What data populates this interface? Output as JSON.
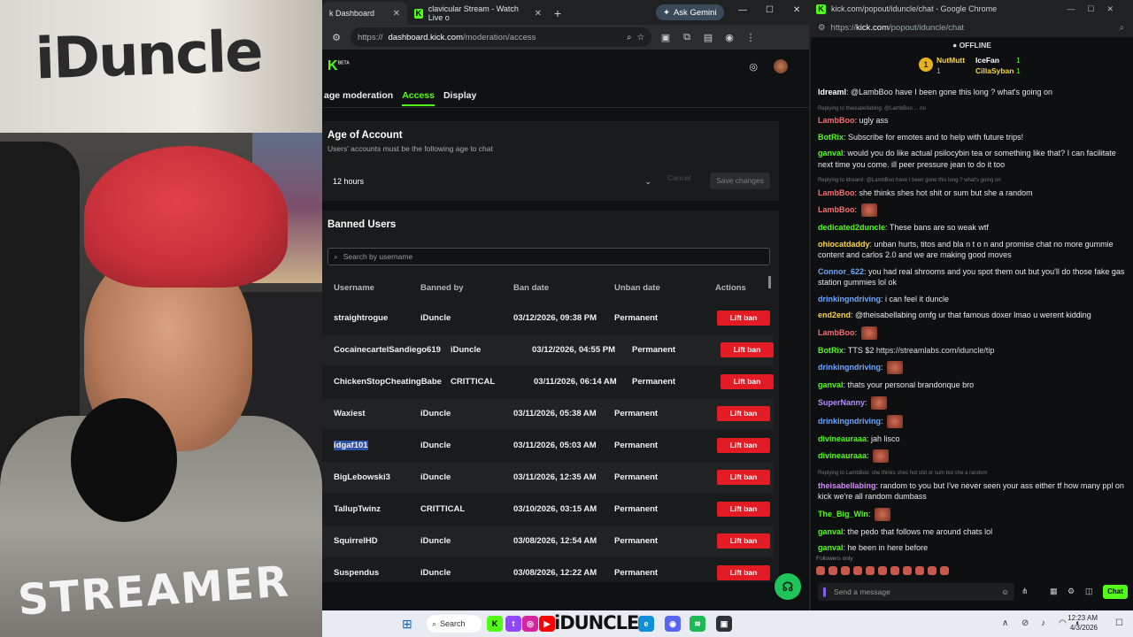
{
  "webcam": {
    "wall_logo": "iDuncle",
    "shirt_text": "STREAMER"
  },
  "browser": {
    "tabs": [
      {
        "label": "k Dashboard",
        "close": "✕"
      },
      {
        "label": "clavicular Stream - Watch Live o",
        "close": "✕"
      }
    ],
    "new_tab": "+",
    "gemini_label": "Ask Gemini",
    "window_controls": [
      "—",
      "☐",
      "✕"
    ],
    "url_prefix": "https://",
    "url_host": "dashboard.kick.com",
    "url_path": "/moderation/access"
  },
  "kick": {
    "logo": "K",
    "logo_badge": "BETA",
    "subtabs": [
      "age moderation",
      "Access",
      "Display"
    ],
    "age": {
      "title": "Age of Account",
      "subtitle": "Users' accounts must be the following age to chat",
      "selected": "12 hours",
      "cancel": "Cancel",
      "save": "Save changes"
    },
    "banned": {
      "title": "Banned Users",
      "search_placeholder": "Search by username",
      "columns": [
        "Username",
        "Banned by",
        "Ban date",
        "Unban date",
        "Actions"
      ],
      "lift_label": "Lift ban",
      "rows": [
        {
          "username": "straightrogue",
          "banned_by": "iDuncle",
          "ban_date": "03/12/2026, 09:38 PM",
          "unban": "Permanent"
        },
        {
          "username": "CocainecartelSandiego619",
          "banned_by": "iDuncle",
          "ban_date": "03/12/2026, 04:55 PM",
          "unban": "Permanent"
        },
        {
          "username": "ChickenStopCheatingBabe",
          "banned_by": "CRITTICAL",
          "ban_date": "03/11/2026, 06:14 AM",
          "unban": "Permanent"
        },
        {
          "username": "Waxiest",
          "banned_by": "iDuncle",
          "ban_date": "03/11/2026, 05:38 AM",
          "unban": "Permanent"
        },
        {
          "username": "idgaf101",
          "banned_by": "iDuncle",
          "ban_date": "03/11/2026, 05:03 AM",
          "unban": "Permanent"
        },
        {
          "username": "BigLebowski3",
          "banned_by": "iDuncle",
          "ban_date": "03/11/2026, 12:35 AM",
          "unban": "Permanent"
        },
        {
          "username": "TallupTwinz",
          "banned_by": "CRITTICAL",
          "ban_date": "03/10/2026, 03:15 AM",
          "unban": "Permanent"
        },
        {
          "username": "SquirrelHD",
          "banned_by": "iDuncle",
          "ban_date": "03/08/2026, 12:54 AM",
          "unban": "Permanent"
        },
        {
          "username": "Suspendus",
          "banned_by": "iDuncle",
          "ban_date": "03/08/2026, 12:22 AM",
          "unban": "Permanent"
        }
      ]
    }
  },
  "chat": {
    "window_title": "kick.com/popout/iduncle/chat - Google Chrome",
    "url_prefix": "https://",
    "url_host": "kick.com",
    "url_path": "/popout/iduncle/chat",
    "status": "OFFLINE",
    "leaders": [
      {
        "rank": "1",
        "name": "NutMutt",
        "count": "1"
      },
      {
        "name": "IceFan",
        "count": "1"
      },
      {
        "name": "CillaSyban",
        "count": "1"
      }
    ],
    "messages": [
      {
        "user": "ldreaml",
        "color": "#ffffff",
        "text": "@LambBoo have I been gone this long ? what's going on"
      },
      {
        "reply": "Replying to theisabellabing: @LambBoo ... no",
        "user": "LambBoo",
        "color": "#ff6b6b",
        "text": "ugly ass"
      },
      {
        "user": "BotRix",
        "color": "#53fc18",
        "text": "Subscribe for emotes and to help with future trips!"
      },
      {
        "user": "ganval",
        "color": "#53fc18",
        "text": "would you do like actual psilocybin tea or something like that? I can facilitate next time you come. ill peer pressure jean to do it too"
      },
      {
        "reply": "Replying to ldreaml: @LambBoo have I been gone this long ? what's going on",
        "user": "LambBoo",
        "color": "#ff6b6b",
        "text": "she thinks shes hot shit or sum but she a random"
      },
      {
        "user": "LambBoo",
        "color": "#ff6b6b",
        "text": ""
      },
      {
        "user": "dedicated2duncle",
        "color": "#53fc18",
        "text": "These bans are so weak wtf"
      },
      {
        "user": "ohiocatdaddy",
        "color": "#f6d44a",
        "text": "unban hurts, titos and bla n t o n and promise chat no more gummie content and carlos 2.0 and we are making good moves"
      },
      {
        "user": "Connor_622",
        "color": "#6aa7ff",
        "text": "you had real shrooms and you spot them out but you'll do those fake gas station gummies lol ok"
      },
      {
        "user": "drinkingndriving",
        "color": "#6aa7ff",
        "text": "i can feel it duncle"
      },
      {
        "user": "end2end",
        "color": "#f6d44a",
        "text": "@theisabellabing omfg ur that famous doxer lmao u werent kidding"
      },
      {
        "user": "LambBoo",
        "color": "#ff6b6b",
        "text": ""
      },
      {
        "user": "BotRix",
        "color": "#53fc18",
        "text": "TTS $2",
        "link": "https://streamlabs.com/iduncle/tip"
      },
      {
        "user": "drinkingndriving",
        "color": "#6aa7ff",
        "text": ""
      },
      {
        "user": "ganval",
        "color": "#53fc18",
        "text": "thats your personal brandonque bro"
      },
      {
        "user": "SuperNanny",
        "color": "#b58cff",
        "text": ""
      },
      {
        "user": "drinkingndriving",
        "color": "#6aa7ff",
        "text": ""
      },
      {
        "user": "divineauraaa",
        "color": "#53fc18",
        "text": "jah lisco"
      },
      {
        "user": "divineauraaa",
        "color": "#53fc18",
        "text": ""
      },
      {
        "reply": "Replying to LambBoo: she thinks shes hot shit or sum but she a random",
        "user": "theisabellabing",
        "color": "#d48cff",
        "text": "random to you but I've never seen your ass either tf how many ppl on kick we're all random dumbass"
      },
      {
        "user": "The_Big_Win",
        "color": "#53fc18",
        "text": ""
      },
      {
        "user": "ganval",
        "color": "#53fc18",
        "text": "the pedo that follows me around chats lol"
      },
      {
        "user": "ganval",
        "color": "#53fc18",
        "text": "he been in here before"
      }
    ],
    "followers_only": "Followers only",
    "input_placeholder": "Send a message",
    "send_label": "Chat"
  },
  "taskbar": {
    "search_label": "Search",
    "brand": "iDUNCLE",
    "time": "12:23 AM",
    "date": "4/3/2026"
  }
}
